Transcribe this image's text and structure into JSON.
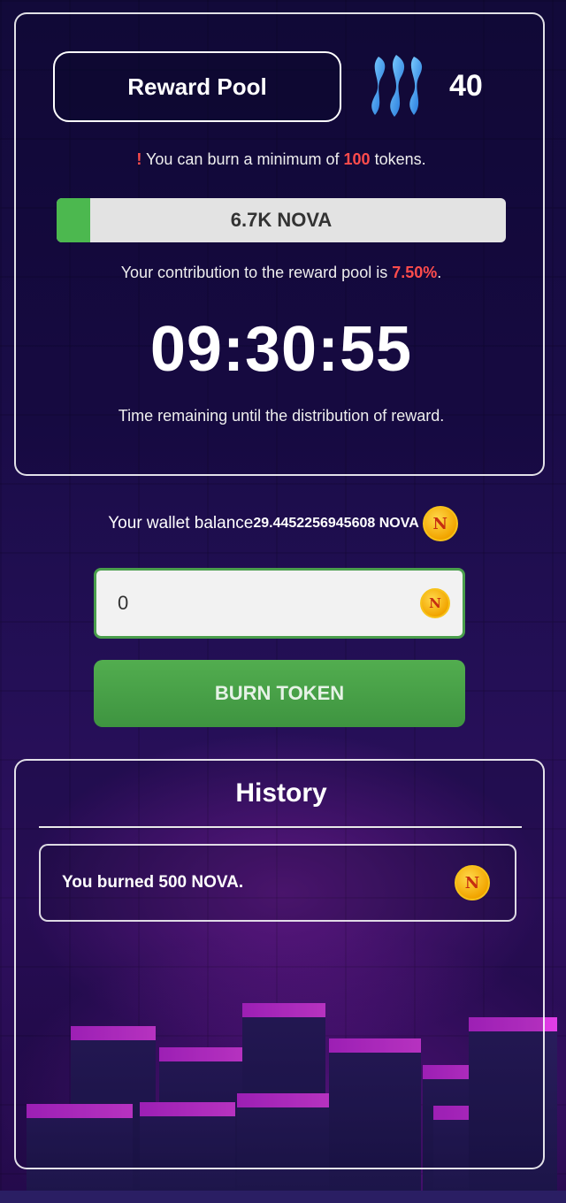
{
  "reward_pool": {
    "button_label": "Reward Pool",
    "count": "40",
    "icon": "steem-icon"
  },
  "notice": {
    "mark": "!",
    "prefix": "You can burn a minimum of",
    "amount": "100",
    "suffix": "tokens."
  },
  "pool_progress": {
    "label": "6.7K NOVA",
    "fraction": 0.075
  },
  "contribution": {
    "prefix": "Your contribution to the reward pool is",
    "percent": "7.50%",
    "suffix": "."
  },
  "timer": {
    "value": "09:30:55",
    "caption": "Time remaining until the distribution of reward."
  },
  "wallet": {
    "label": "Your wallet balance",
    "balance": "29.4452256945608 NOVA",
    "icon": "nova-coin-icon"
  },
  "burn_form": {
    "amount_value": "0",
    "button_label": "BURN TOKEN"
  },
  "history": {
    "title": "History",
    "items": [
      {
        "text": "You burned 500 NOVA.",
        "icon": "nova-coin-icon"
      }
    ]
  },
  "colors": {
    "accent_green": "#4cb84f",
    "highlight_red": "#ff4c4c",
    "coin_gold": "#f2a500"
  }
}
